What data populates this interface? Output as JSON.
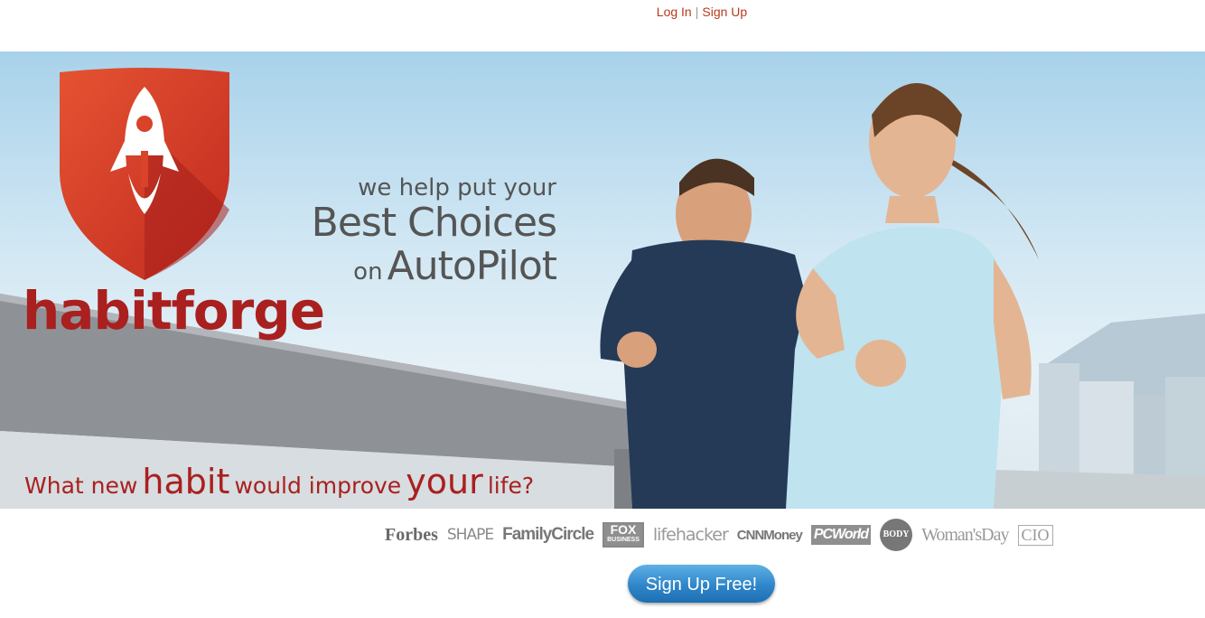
{
  "header": {
    "login_label": "Log In",
    "separator": "|",
    "signup_label": "Sign Up"
  },
  "brand": {
    "name": "habitforge",
    "logo_icon": "rocket-shield-icon",
    "color": "#a9201f"
  },
  "tagline": {
    "line1": "we help put your",
    "line2": "Best Choices",
    "line3_prefix": "on",
    "line3_main": "AutoPilot"
  },
  "question": {
    "part1": "What new",
    "part2": "habit",
    "part3": "would improve",
    "part4": "your",
    "part5": "life?"
  },
  "press": {
    "forbes": "Forbes",
    "shape": "SHAPE",
    "familycircle": "FamilyCircle",
    "fox_line1": "FOX",
    "fox_line2": "BUSINESS",
    "lifehacker": "lifehacker",
    "cnnmoney": "CNNMoney",
    "pcworld": "PCWorld",
    "body": "BODY",
    "womansday": "Woman'sDay",
    "cio": "CIO"
  },
  "cta": {
    "label": "Sign Up Free!",
    "color": "#2f86c9"
  }
}
